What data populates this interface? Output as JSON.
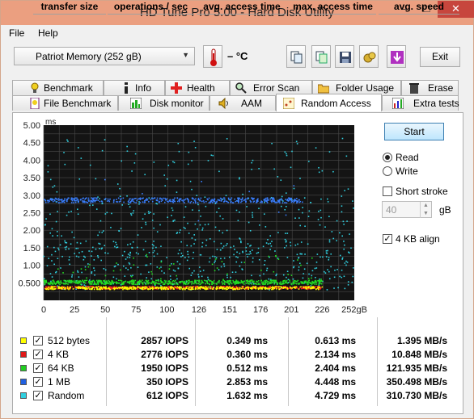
{
  "window": {
    "title": "HD Tune Pro 5.00 - Hard Disk Utility",
    "minimize": "–",
    "maximize": "□",
    "close": "✕"
  },
  "menu": {
    "file": "File",
    "help": "Help"
  },
  "toolbar": {
    "drive": "Patriot Memory   (252 gB)",
    "temperature": "– °C",
    "exit": "Exit",
    "icons": [
      "copy-icon",
      "copy-alt-icon",
      "save-icon",
      "options-icon",
      "download-icon"
    ]
  },
  "tabs_top": [
    "Benchmark",
    "Info",
    "Health",
    "Error Scan",
    "Folder Usage",
    "Erase"
  ],
  "tabs_bottom": [
    "File Benchmark",
    "Disk monitor",
    "AAM",
    "Random Access",
    "Extra tests"
  ],
  "active_tab": "Random Access",
  "controls": {
    "start": "Start",
    "read": "Read",
    "write": "Write",
    "mode": "Read",
    "short_stroke": "Short stroke",
    "short_stroke_checked": false,
    "short_stroke_value": "40",
    "short_stroke_unit": "gB",
    "align": "4 KB align",
    "align_checked": true
  },
  "chart_data": {
    "type": "scatter",
    "ylabel": "ms",
    "y_ticks": [
      "5.00",
      "4.50",
      "4.00",
      "3.50",
      "3.00",
      "2.50",
      "2.00",
      "1.50",
      "1.00",
      "0.500"
    ],
    "x_ticks": [
      "0",
      "25",
      "50",
      "75",
      "100",
      "126",
      "151",
      "176",
      "201",
      "226",
      "252gB"
    ],
    "xlim": [
      0,
      252
    ],
    "ylim": [
      0,
      5
    ],
    "grid": true,
    "series": [
      {
        "name": "512 bytes",
        "color": "#ffff00",
        "avg_ms": 0.349,
        "max_ms": 0.613
      },
      {
        "name": "4 KB",
        "color": "#ff2020",
        "avg_ms": 0.36,
        "max_ms": 2.134
      },
      {
        "name": "64 KB",
        "color": "#22dd22",
        "avg_ms": 0.512,
        "max_ms": 2.404
      },
      {
        "name": "1 MB",
        "color": "#3a7fff",
        "avg_ms": 2.853,
        "max_ms": 4.448
      },
      {
        "name": "Random",
        "color": "#30d0e0",
        "avg_ms": 1.632,
        "max_ms": 4.729
      }
    ]
  },
  "table": {
    "headers": [
      "transfer size",
      "operations / sec",
      "avg. access time",
      "max. access time",
      "avg. speed"
    ],
    "rows": [
      {
        "color": "#ffff00",
        "size": "512 bytes",
        "ops": "2857 IOPS",
        "avg": "0.349 ms",
        "max": "0.613 ms",
        "speed": "1.395 MB/s"
      },
      {
        "color": "#e01818",
        "size": "4 KB",
        "ops": "2776 IOPS",
        "avg": "0.360 ms",
        "max": "2.134 ms",
        "speed": "10.848 MB/s"
      },
      {
        "color": "#22cc22",
        "size": "64 KB",
        "ops": "1950 IOPS",
        "avg": "0.512 ms",
        "max": "2.404 ms",
        "speed": "121.935 MB/s"
      },
      {
        "color": "#2060e0",
        "size": "1 MB",
        "ops": "350 IOPS",
        "avg": "2.853 ms",
        "max": "4.448 ms",
        "speed": "350.498 MB/s"
      },
      {
        "color": "#30d0e0",
        "size": "Random",
        "ops": "612 IOPS",
        "avg": "1.632 ms",
        "max": "4.729 ms",
        "speed": "310.730 MB/s"
      }
    ]
  }
}
